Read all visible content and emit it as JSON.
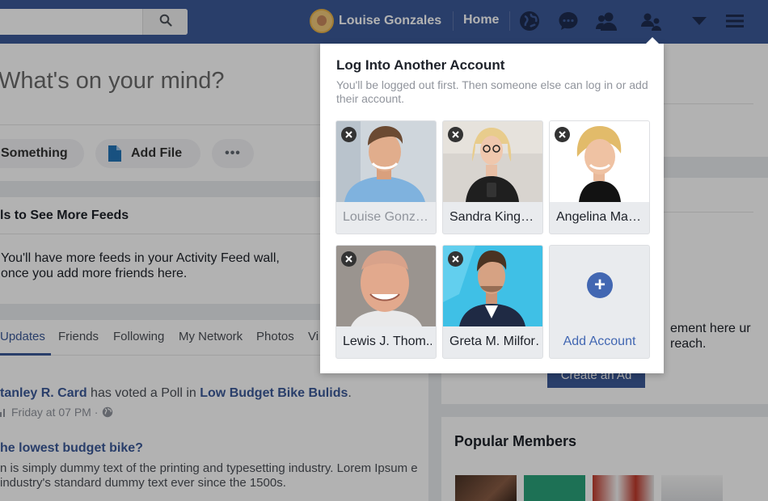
{
  "topbar": {
    "user_name": "Louise Gonzales",
    "home_label": "Home",
    "icons": [
      "search-icon",
      "globe-icon",
      "messages-icon",
      "friends-icon",
      "switch-account-icon",
      "caret-down-icon",
      "menu-icon"
    ]
  },
  "composer": {
    "prompt": "What's on your mind?",
    "action_something": "Something",
    "action_add_file": "Add File",
    "more": "•••"
  },
  "friends_hint": {
    "title": "ls to See More Feeds",
    "text": "You'll have more feeds in your Activity Feed wall, once you add more friends here."
  },
  "feed_tabs": [
    "Updates",
    "Friends",
    "Following",
    "My Network",
    "Photos",
    "Vi"
  ],
  "post": {
    "author": "tanley R. Card",
    "action": "has voted a Poll in",
    "group": "Low Budget Bike Bulids",
    "time": "Friday at 07 PM ·",
    "question": "he lowest budget bike?",
    "body": "n is simply dummy text of the printing and typesetting industry. Lorem Ipsum e industry's standard dummy text ever since the 1500s."
  },
  "right": {
    "ad_text": "ement here ur reach.",
    "create_ad": "Create an Ad",
    "popular_members": "Popular Members"
  },
  "modal": {
    "title": "Log Into Another Account",
    "subtitle": "You'll be logged out first. Then someone else can log in or add their account.",
    "accounts": [
      {
        "name": "Louise Gonz…",
        "current": true
      },
      {
        "name": "Sandra King…",
        "current": false
      },
      {
        "name": "Angelina Ma…",
        "current": false
      },
      {
        "name": "Lewis J. Thom..",
        "current": false
      },
      {
        "name": "Greta M. Milfor…",
        "current": false
      }
    ],
    "add_account": "Add Account",
    "add_symbol": "+"
  },
  "colors": {
    "brand": "#3b5998",
    "accent": "#4267b2",
    "background": "#e9ebee"
  }
}
